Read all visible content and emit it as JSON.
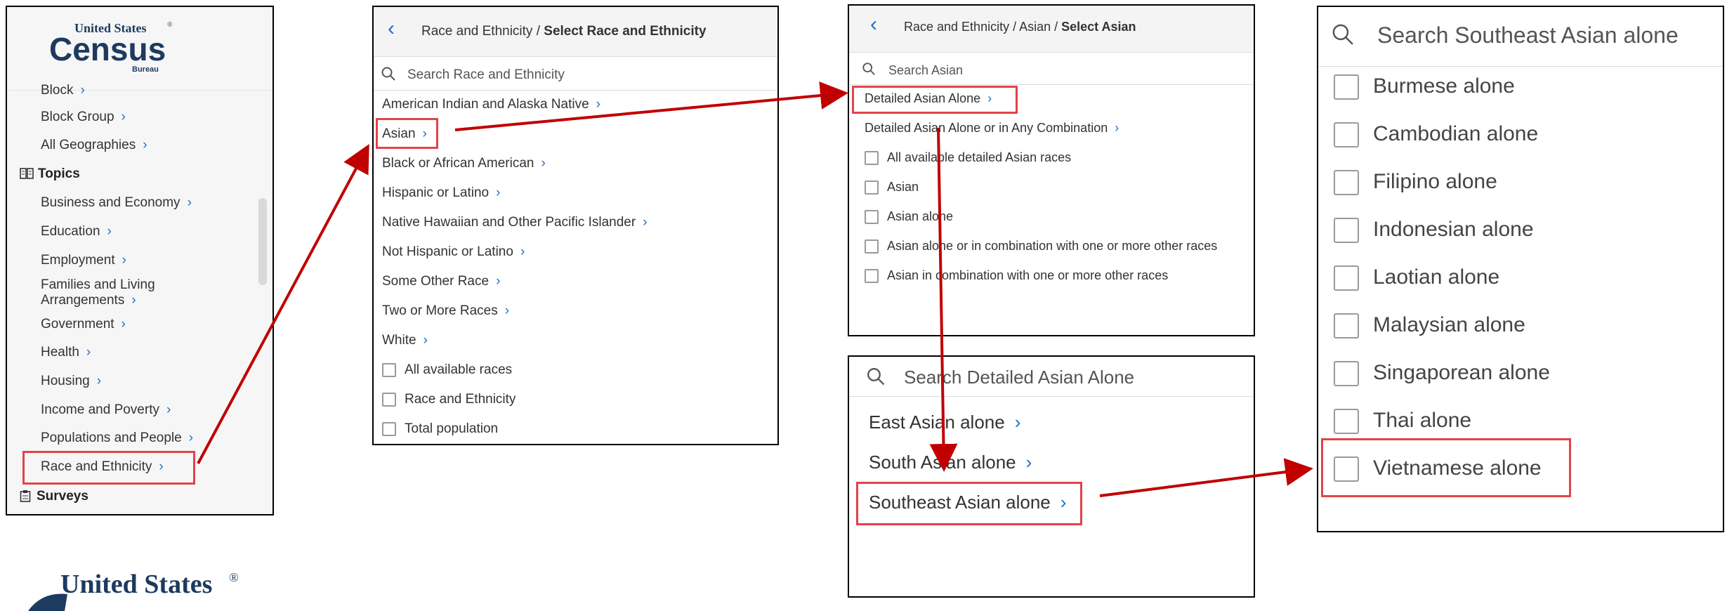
{
  "brand": {
    "line1": "United States",
    "reg": "®",
    "word": "Census",
    "sub": "Bureau"
  },
  "sidebar": {
    "partial_item": "Block",
    "geo_items": [
      "Block Group",
      "All Geographies"
    ],
    "topics_header": "Topics",
    "topic_items": [
      "Business and Economy",
      "Education",
      "Employment",
      "Families and Living",
      "Arrangements",
      "Government",
      "Health",
      "Housing",
      "Income and Poverty",
      "Populations and People",
      "Race and Ethnicity"
    ],
    "surveys_header": "Surveys"
  },
  "race_panel": {
    "breadcrumb_parent": "Race and Ethnicity / ",
    "breadcrumb_current": "Select Race and Ethnicity",
    "search_placeholder": "Search Race and Ethnicity",
    "items": [
      "American Indian and Alaska Native",
      "Asian",
      "Black or African American",
      "Hispanic or Latino",
      "Native Hawaiian and Other Pacific Islander",
      "Not Hispanic or Latino",
      "Some Other Race",
      "Two or More Races",
      "White"
    ],
    "checkboxes": [
      "All available races",
      "Race and Ethnicity",
      "Total population"
    ]
  },
  "asian_panel": {
    "breadcrumb_parent": "Race and Ethnicity / Asian / ",
    "breadcrumb_current": "Select Asian",
    "search_placeholder": "Search Asian",
    "items": [
      "Detailed Asian Alone",
      "Detailed Asian Alone or in Any Combination"
    ],
    "checkboxes": [
      "All available detailed Asian races",
      "Asian",
      "Asian alone",
      "Asian alone or in combination with one or more other races",
      "Asian in combination with one or more other races"
    ]
  },
  "detailed_panel": {
    "search_placeholder": "Search Detailed Asian Alone",
    "items": [
      "East Asian alone",
      "South Asian alone",
      "Southeast Asian alone"
    ]
  },
  "southeast_panel": {
    "search_placeholder": "Search Southeast Asian alone",
    "checkboxes": [
      "Burmese alone",
      "Cambodian alone",
      "Filipino alone",
      "Indonesian alone",
      "Laotian alone",
      "Malaysian alone",
      "Singaporean alone",
      "Thai alone",
      "Vietnamese alone"
    ]
  },
  "colors": {
    "accent_blue": "#1f6fc9",
    "highlight_red": "#e0444a",
    "arrow_red": "#c00000",
    "logo_navy": "#1d3a5f"
  },
  "icons": {
    "chevron": "›",
    "back": "‹"
  }
}
